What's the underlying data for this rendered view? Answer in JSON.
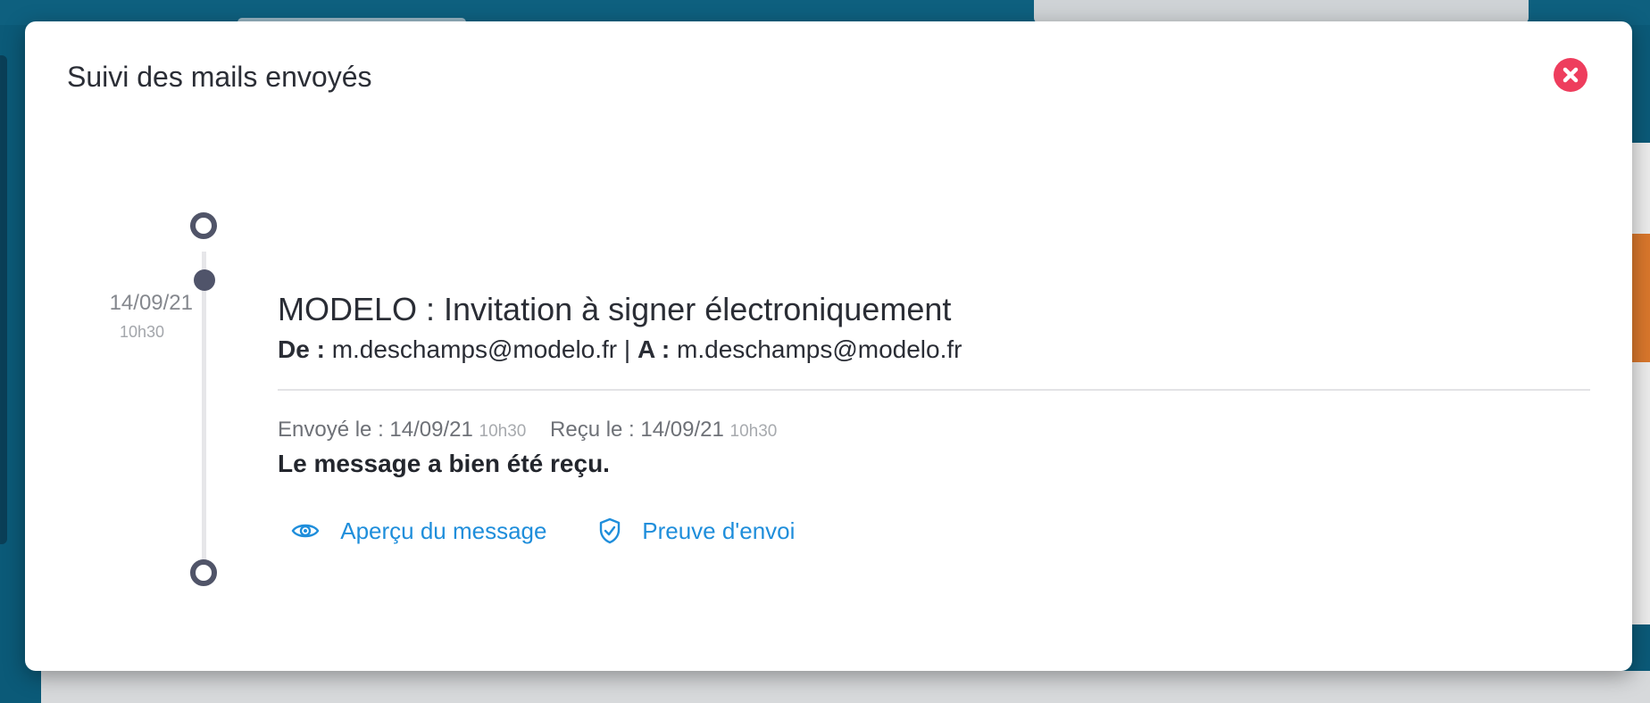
{
  "modal": {
    "title": "Suivi des mails envoyés",
    "close_icon": "close-icon"
  },
  "timeline": {
    "entry": {
      "date": "14/09/21",
      "time": "10h30",
      "subject": "MODELO : Invitation à signer électroniquement",
      "from_label": "De :",
      "from": "m.deschamps@modelo.fr",
      "separator": "|",
      "to_label": "A :",
      "to": "m.deschamps@modelo.fr",
      "sent_label": "Envoyé le :",
      "sent_date": "14/09/21",
      "sent_time": "10h30",
      "received_label": "Reçu le :",
      "received_date": "14/09/21",
      "received_time": "10h30",
      "status": "Le message a bien été reçu.",
      "actions": {
        "preview": {
          "label": "Aperçu du message",
          "icon": "eye-icon"
        },
        "proof": {
          "label": "Preuve d'envoi",
          "icon": "shield-check-icon"
        }
      }
    }
  },
  "colors": {
    "accent": "#1f8edb",
    "close": "#ee3d5d",
    "timeline": "#505468"
  }
}
